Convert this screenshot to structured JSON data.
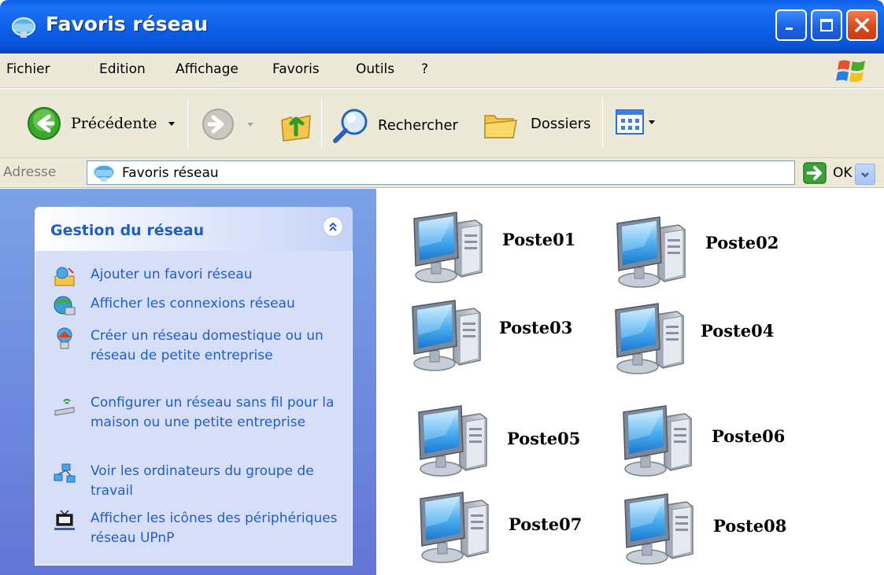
{
  "window": {
    "title": "Favoris réseau"
  },
  "menubar": {
    "items": [
      "Fichier",
      "Edition",
      "Affichage",
      "Favoris",
      "Outils",
      "?"
    ]
  },
  "toolbar": {
    "back_label": "Précédente",
    "search_label": "Rechercher",
    "folders_label": "Dossiers"
  },
  "address": {
    "label": "Adresse",
    "value": "Favoris réseau",
    "go_label": "OK"
  },
  "task_pane": {
    "title": "Gestion du réseau",
    "tasks": [
      {
        "label": "Ajouter un favori réseau",
        "icon": "add-network-place-icon"
      },
      {
        "label": "Afficher les connexions réseau",
        "icon": "network-connections-icon"
      },
      {
        "label": "Créer un réseau domestique ou un réseau de petite entreprise",
        "icon": "home-network-icon"
      },
      {
        "label": "Configurer un réseau sans fil pour la maison ou une petite entreprise",
        "icon": "wireless-network-icon"
      },
      {
        "label": "Voir les ordinateurs du groupe de travail",
        "icon": "workgroup-icon"
      },
      {
        "label": "Afficher les icônes des périphériques réseau UPnP",
        "icon": "upnp-device-icon"
      }
    ]
  },
  "computers": [
    {
      "label": "Poste01"
    },
    {
      "label": "Poste02"
    },
    {
      "label": "Poste03"
    },
    {
      "label": "Poste04"
    },
    {
      "label": "Poste05"
    },
    {
      "label": "Poste06"
    },
    {
      "label": "Poste07"
    },
    {
      "label": "Poste08"
    }
  ],
  "colors": {
    "titlebar": "#0a5fe6",
    "taskpane": "#6f8fe0",
    "task_link": "#215dc6",
    "close_button": "#d9461b"
  }
}
